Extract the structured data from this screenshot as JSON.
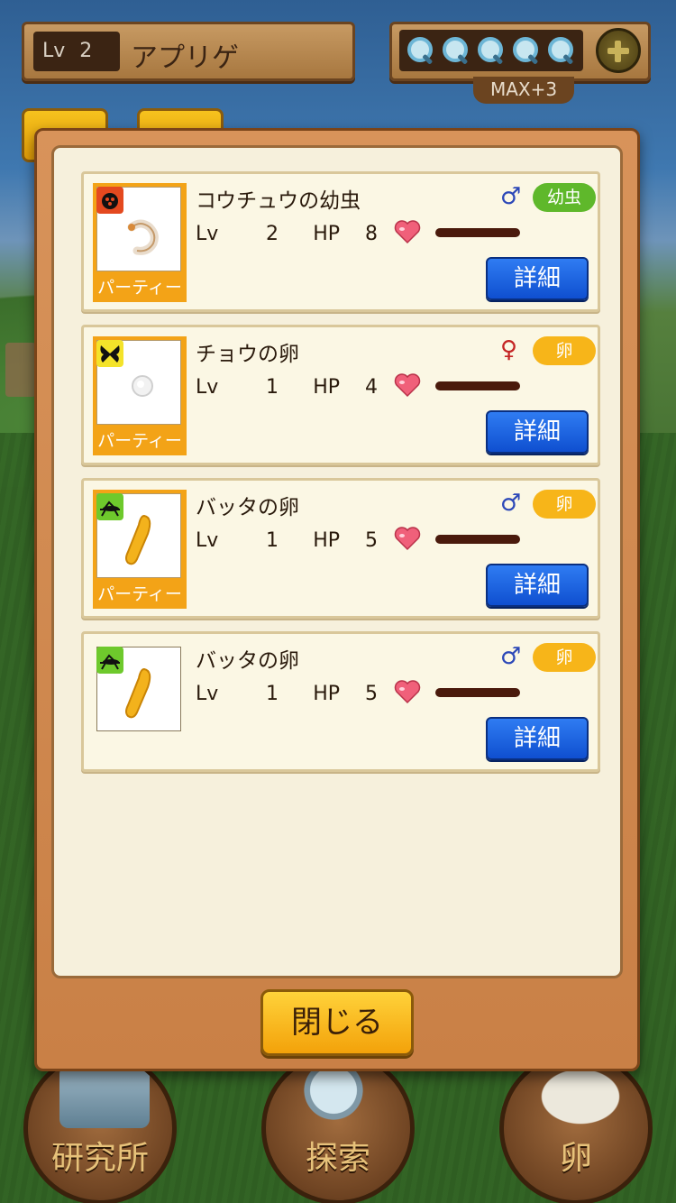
{
  "hud": {
    "level_label": "Lv",
    "level_value": "2",
    "player_name": "アプリゲ",
    "search_max": "MAX+3"
  },
  "nav": {
    "lab_label": "研究所",
    "explore_label": "探索",
    "egg_label": "卵"
  },
  "insects": [
    {
      "name": "コウチュウの幼虫",
      "lv_label": "Lv",
      "lv": "2",
      "hp_label": "HP",
      "hp": "8",
      "sex": "♂",
      "stage": "幼虫",
      "party_tag": "パーティー",
      "detail": "詳細",
      "badge_icon": "beetle-icon"
    },
    {
      "name": "チョウの卵",
      "lv_label": "Lv",
      "lv": "1",
      "hp_label": "HP",
      "hp": "4",
      "sex": "♀",
      "stage": "卵",
      "party_tag": "パーティー",
      "detail": "詳細",
      "badge_icon": "butterfly-icon"
    },
    {
      "name": "バッタの卵",
      "lv_label": "Lv",
      "lv": "1",
      "hp_label": "HP",
      "hp": "5",
      "sex": "♂",
      "stage": "卵",
      "party_tag": "パーティー",
      "detail": "詳細",
      "badge_icon": "grasshopper-icon"
    },
    {
      "name": "バッタの卵",
      "lv_label": "Lv",
      "lv": "1",
      "hp_label": "HP",
      "hp": "5",
      "sex": "♂",
      "stage": "卵",
      "detail": "詳細",
      "badge_icon": "grasshopper-icon"
    }
  ],
  "close_label": "閉じる",
  "colors": {
    "party_orange": "#f3a317",
    "larva_green": "#5fb82b",
    "egg_yellow": "#f7b519",
    "detail_blue": "#1f66e0",
    "male_blue": "#2c48b8",
    "female_red": "#c42424"
  }
}
